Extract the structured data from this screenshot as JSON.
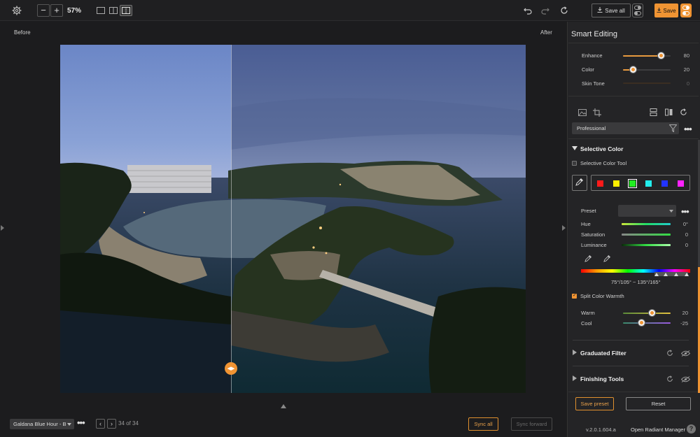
{
  "toolbar": {
    "zoom": "57%",
    "zoom_out": "−",
    "zoom_in": "+",
    "save_all_label": "Save all",
    "save_label": "Save"
  },
  "canvas": {
    "before_label": "Before",
    "after_label": "After",
    "split_handle_glyph": "◀▶"
  },
  "bottom_bar": {
    "preset_name": "Galdana Blue Hour - B",
    "counter": "34 of 34",
    "sync_all": "Sync all",
    "sync_forward": "Sync forward"
  },
  "panel": {
    "title": "Smart Editing",
    "sliders": [
      {
        "label": "Enhance",
        "value": "80",
        "fraction": 0.8,
        "enabled": true
      },
      {
        "label": "Color",
        "value": "20",
        "fraction": 0.2,
        "enabled": true
      },
      {
        "label": "Skin Tone",
        "value": "0",
        "fraction": 0.0,
        "enabled": false
      }
    ],
    "profile": "Professional",
    "selective_color": {
      "title": "Selective Color",
      "tool_label": "Selective Color Tool",
      "tool_checked": false,
      "swatches": [
        "#ff1a1a",
        "#ffee00",
        "#22ee22",
        "#22eeee",
        "#2233ff",
        "#ff22ff"
      ],
      "selected_swatch": 2,
      "preset_label": "Preset",
      "adjustments": [
        {
          "label": "Hue",
          "value": "0°"
        },
        {
          "label": "Saturation",
          "value": "0"
        },
        {
          "label": "Luminance",
          "value": "0"
        }
      ],
      "hue_range": "75°/105° ~ 135°/165°"
    },
    "split_warmth": {
      "label": "Split Color Warmth",
      "checked": true,
      "sliders": [
        {
          "label": "Warm",
          "value": "20",
          "fraction": 0.6
        },
        {
          "label": "Cool",
          "value": "-25",
          "fraction": 0.375
        }
      ]
    },
    "sections": [
      {
        "label": "Graduated Filter"
      },
      {
        "label": "Finishing Tools"
      }
    ],
    "save_preset": "Save preset",
    "reset": "Reset",
    "version": "v.2.0.1.604.a",
    "manager_link": "Open Radiant Manager",
    "help": "?"
  },
  "colors": {
    "accent": "#f09433",
    "panel_bg": "#242426",
    "app_bg": "#1c1c1e"
  }
}
